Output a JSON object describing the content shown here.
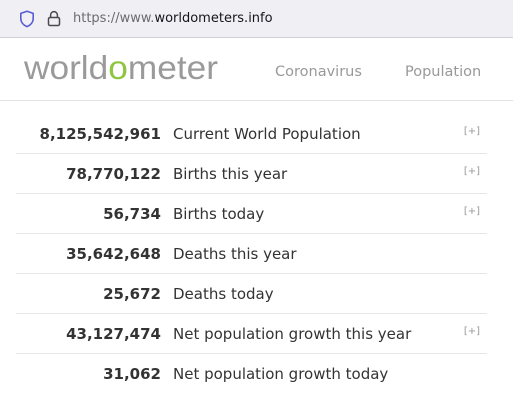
{
  "browser": {
    "url_prefix": "https://www.",
    "url_domain": "worldometers.info",
    "icons": [
      "shield-icon",
      "lock-icon"
    ]
  },
  "site": {
    "logo_text": "worldometer",
    "brand_colors": {
      "logo_gray": "#9a9a9a",
      "logo_green": "#8ec641",
      "text": "#333333",
      "muted": "#999999"
    },
    "nav": {
      "coronavirus": "Coronavirus",
      "population": "Population"
    }
  },
  "counters": [
    {
      "value": "8,125,542,961",
      "label": "Current World Population",
      "expand": "[+]"
    },
    {
      "value": "78,770,122",
      "label": "Births this year",
      "expand": "[+]"
    },
    {
      "value": "56,734",
      "label": "Births today",
      "expand": "[+]"
    },
    {
      "value": "35,642,648",
      "label": "Deaths this year",
      "expand": ""
    },
    {
      "value": "25,672",
      "label": "Deaths today",
      "expand": ""
    },
    {
      "value": "43,127,474",
      "label": "Net population growth this year",
      "expand": "[+]"
    },
    {
      "value": "31,062",
      "label": "Net population growth today",
      "expand": ""
    }
  ]
}
